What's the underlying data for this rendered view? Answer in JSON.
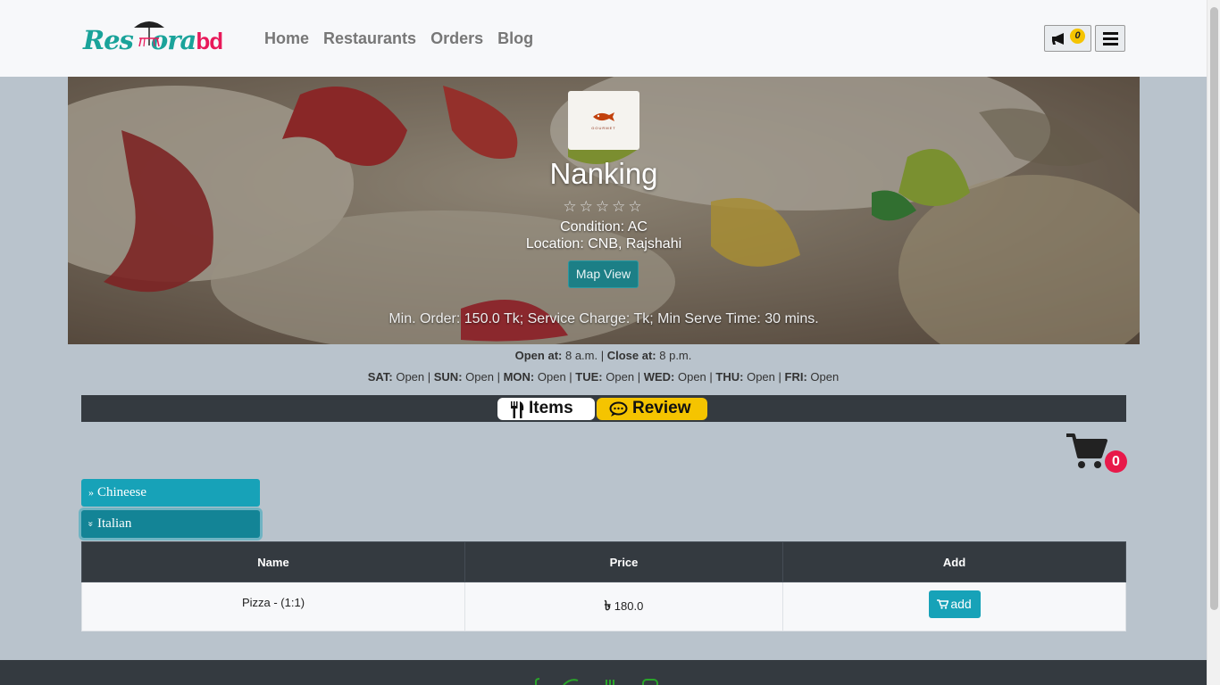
{
  "brand": {
    "logo_left": "Res",
    "logo_mid": "ora",
    "logo_right": "bd",
    "accent_teal": "#1aa39a",
    "accent_pink": "#e8195a"
  },
  "nav": {
    "links": [
      "Home",
      "Restaurants",
      "Orders",
      "Blog"
    ],
    "notification_count": "0",
    "notification_icon": "bullhorn-icon",
    "menu_icon": "hamburger-menu-icon"
  },
  "restaurant": {
    "logo_caption": "GOURMET",
    "name": "Nanking",
    "rating_stars": 0,
    "rating_max": 5,
    "star_glyphs": "☆☆☆☆☆",
    "condition_label": "Condition:",
    "condition_value": "AC",
    "location_label": "Location:",
    "location_value": "CNB, Rajshahi",
    "map_button": "Map View",
    "min_order_text": "Min. Order: 150.0 Tk; Service Charge: Tk; Min Serve Time: 30 mins."
  },
  "hours": {
    "open_label": "Open at:",
    "open_value": "8 a.m.",
    "close_label": "Close at:",
    "close_value": "8 p.m.",
    "days": [
      {
        "day": "SAT:",
        "status": "Open"
      },
      {
        "day": "SUN:",
        "status": "Open"
      },
      {
        "day": "MON:",
        "status": "Open"
      },
      {
        "day": "TUE:",
        "status": "Open"
      },
      {
        "day": "WED:",
        "status": "Open"
      },
      {
        "day": "THU:",
        "status": "Open"
      },
      {
        "day": "FRI:",
        "status": "Open"
      }
    ]
  },
  "tabs": {
    "items_label": "Items",
    "review_label": "Review"
  },
  "cart": {
    "count": "0"
  },
  "categories": [
    {
      "label": "Chineese",
      "expanded": false
    },
    {
      "label": "Italian",
      "expanded": true
    }
  ],
  "table": {
    "headers": [
      "Name",
      "Price",
      "Add"
    ],
    "rows": [
      {
        "name": "Pizza - (1:1)",
        "currency": "৳",
        "price": "180.0",
        "add_label": "add"
      }
    ]
  }
}
